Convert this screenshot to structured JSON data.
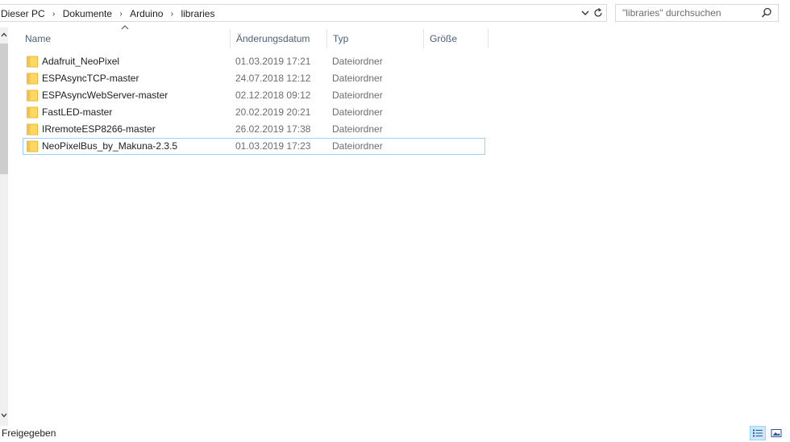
{
  "address": {
    "breadcrumbs": [
      "Dieser PC",
      "Dokumente",
      "Arduino",
      "libraries"
    ],
    "separator": "›"
  },
  "search": {
    "placeholder": "\"libraries\" durchsuchen"
  },
  "columns": {
    "name": "Name",
    "date": "Änderungsdatum",
    "type": "Typ",
    "size": "Größe"
  },
  "files": [
    {
      "name": "Adafruit_NeoPixel",
      "date": "01.03.2019 17:21",
      "type": "Dateiordner"
    },
    {
      "name": "ESPAsyncTCP-master",
      "date": "24.07.2018 12:12",
      "type": "Dateiordner"
    },
    {
      "name": "ESPAsyncWebServer-master",
      "date": "02.12.2018 09:12",
      "type": "Dateiordner"
    },
    {
      "name": "FastLED-master",
      "date": "20.02.2019 20:21",
      "type": "Dateiordner"
    },
    {
      "name": "IRremoteESP8266-master",
      "date": "26.02.2019 17:38",
      "type": "Dateiordner"
    },
    {
      "name": "NeoPixelBus_by_Makuna-2.3.5",
      "date": "01.03.2019 17:23",
      "type": "Dateiordner"
    }
  ],
  "focused_row": 5,
  "status": {
    "text": "Freigegeben"
  },
  "icons": {
    "folder": "folder-icon",
    "search": "search-icon",
    "refresh": "refresh-icon",
    "dropdown": "chevron-down-icon",
    "sort": "sort-ascending-icon"
  },
  "colors": {
    "header_text": "#4c607a",
    "folder": "#ffd766",
    "selection_border": "#99d1ff",
    "secondary_text": "#6d6d6d"
  }
}
